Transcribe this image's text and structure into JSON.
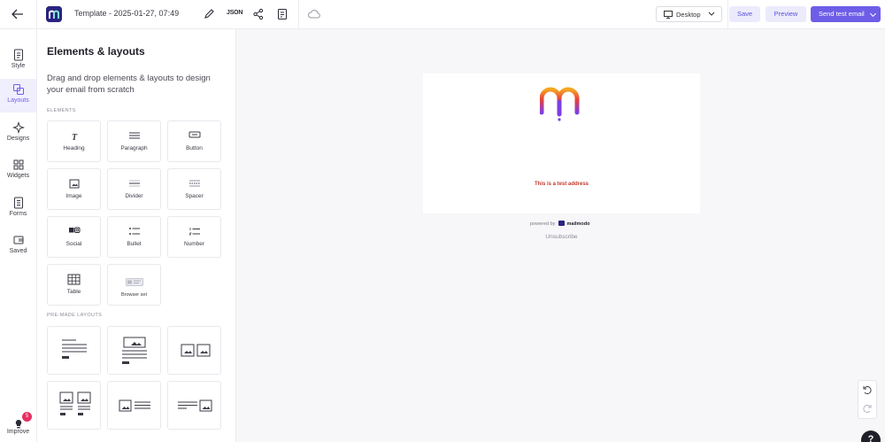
{
  "header": {
    "template_title": "Template - 2025-01-27, 07:49",
    "json_label": "JSON",
    "device": "Desktop",
    "save_label": "Save",
    "preview_label": "Preview",
    "send_label": "Send test email"
  },
  "rail": {
    "items": [
      {
        "label": "Style",
        "icon": "style-icon"
      },
      {
        "label": "Layouts",
        "icon": "layouts-icon",
        "active": true
      },
      {
        "label": "Designs",
        "icon": "designs-icon"
      },
      {
        "label": "Widgets",
        "icon": "widgets-icon"
      },
      {
        "label": "Forms",
        "icon": "forms-icon"
      },
      {
        "label": "Saved",
        "icon": "saved-icon"
      }
    ],
    "improve": {
      "label": "Improve",
      "badge": "5"
    }
  },
  "panel": {
    "title": "Elements & layouts",
    "description": "Drag and drop elements & layouts to design your email from scratch",
    "elements_heading": "ELEMENTS",
    "elements": [
      "Heading",
      "Paragraph",
      "Button",
      "Image",
      "Divider",
      "Spacer",
      "Social",
      "Bullet",
      "Number",
      "Table",
      "Browser set"
    ],
    "layouts_heading": "PRE-MADE LAYOUTS"
  },
  "email": {
    "address_text": "This is a test address",
    "powered_by": "powered by",
    "brand": "mailmodo",
    "unsubscribe": "Unsubscribe"
  },
  "help_label": "?",
  "colors": {
    "accent": "#6e5de7",
    "accent_light": "#ecebfc",
    "badge": "#e62e62",
    "address": "#c0392b"
  }
}
